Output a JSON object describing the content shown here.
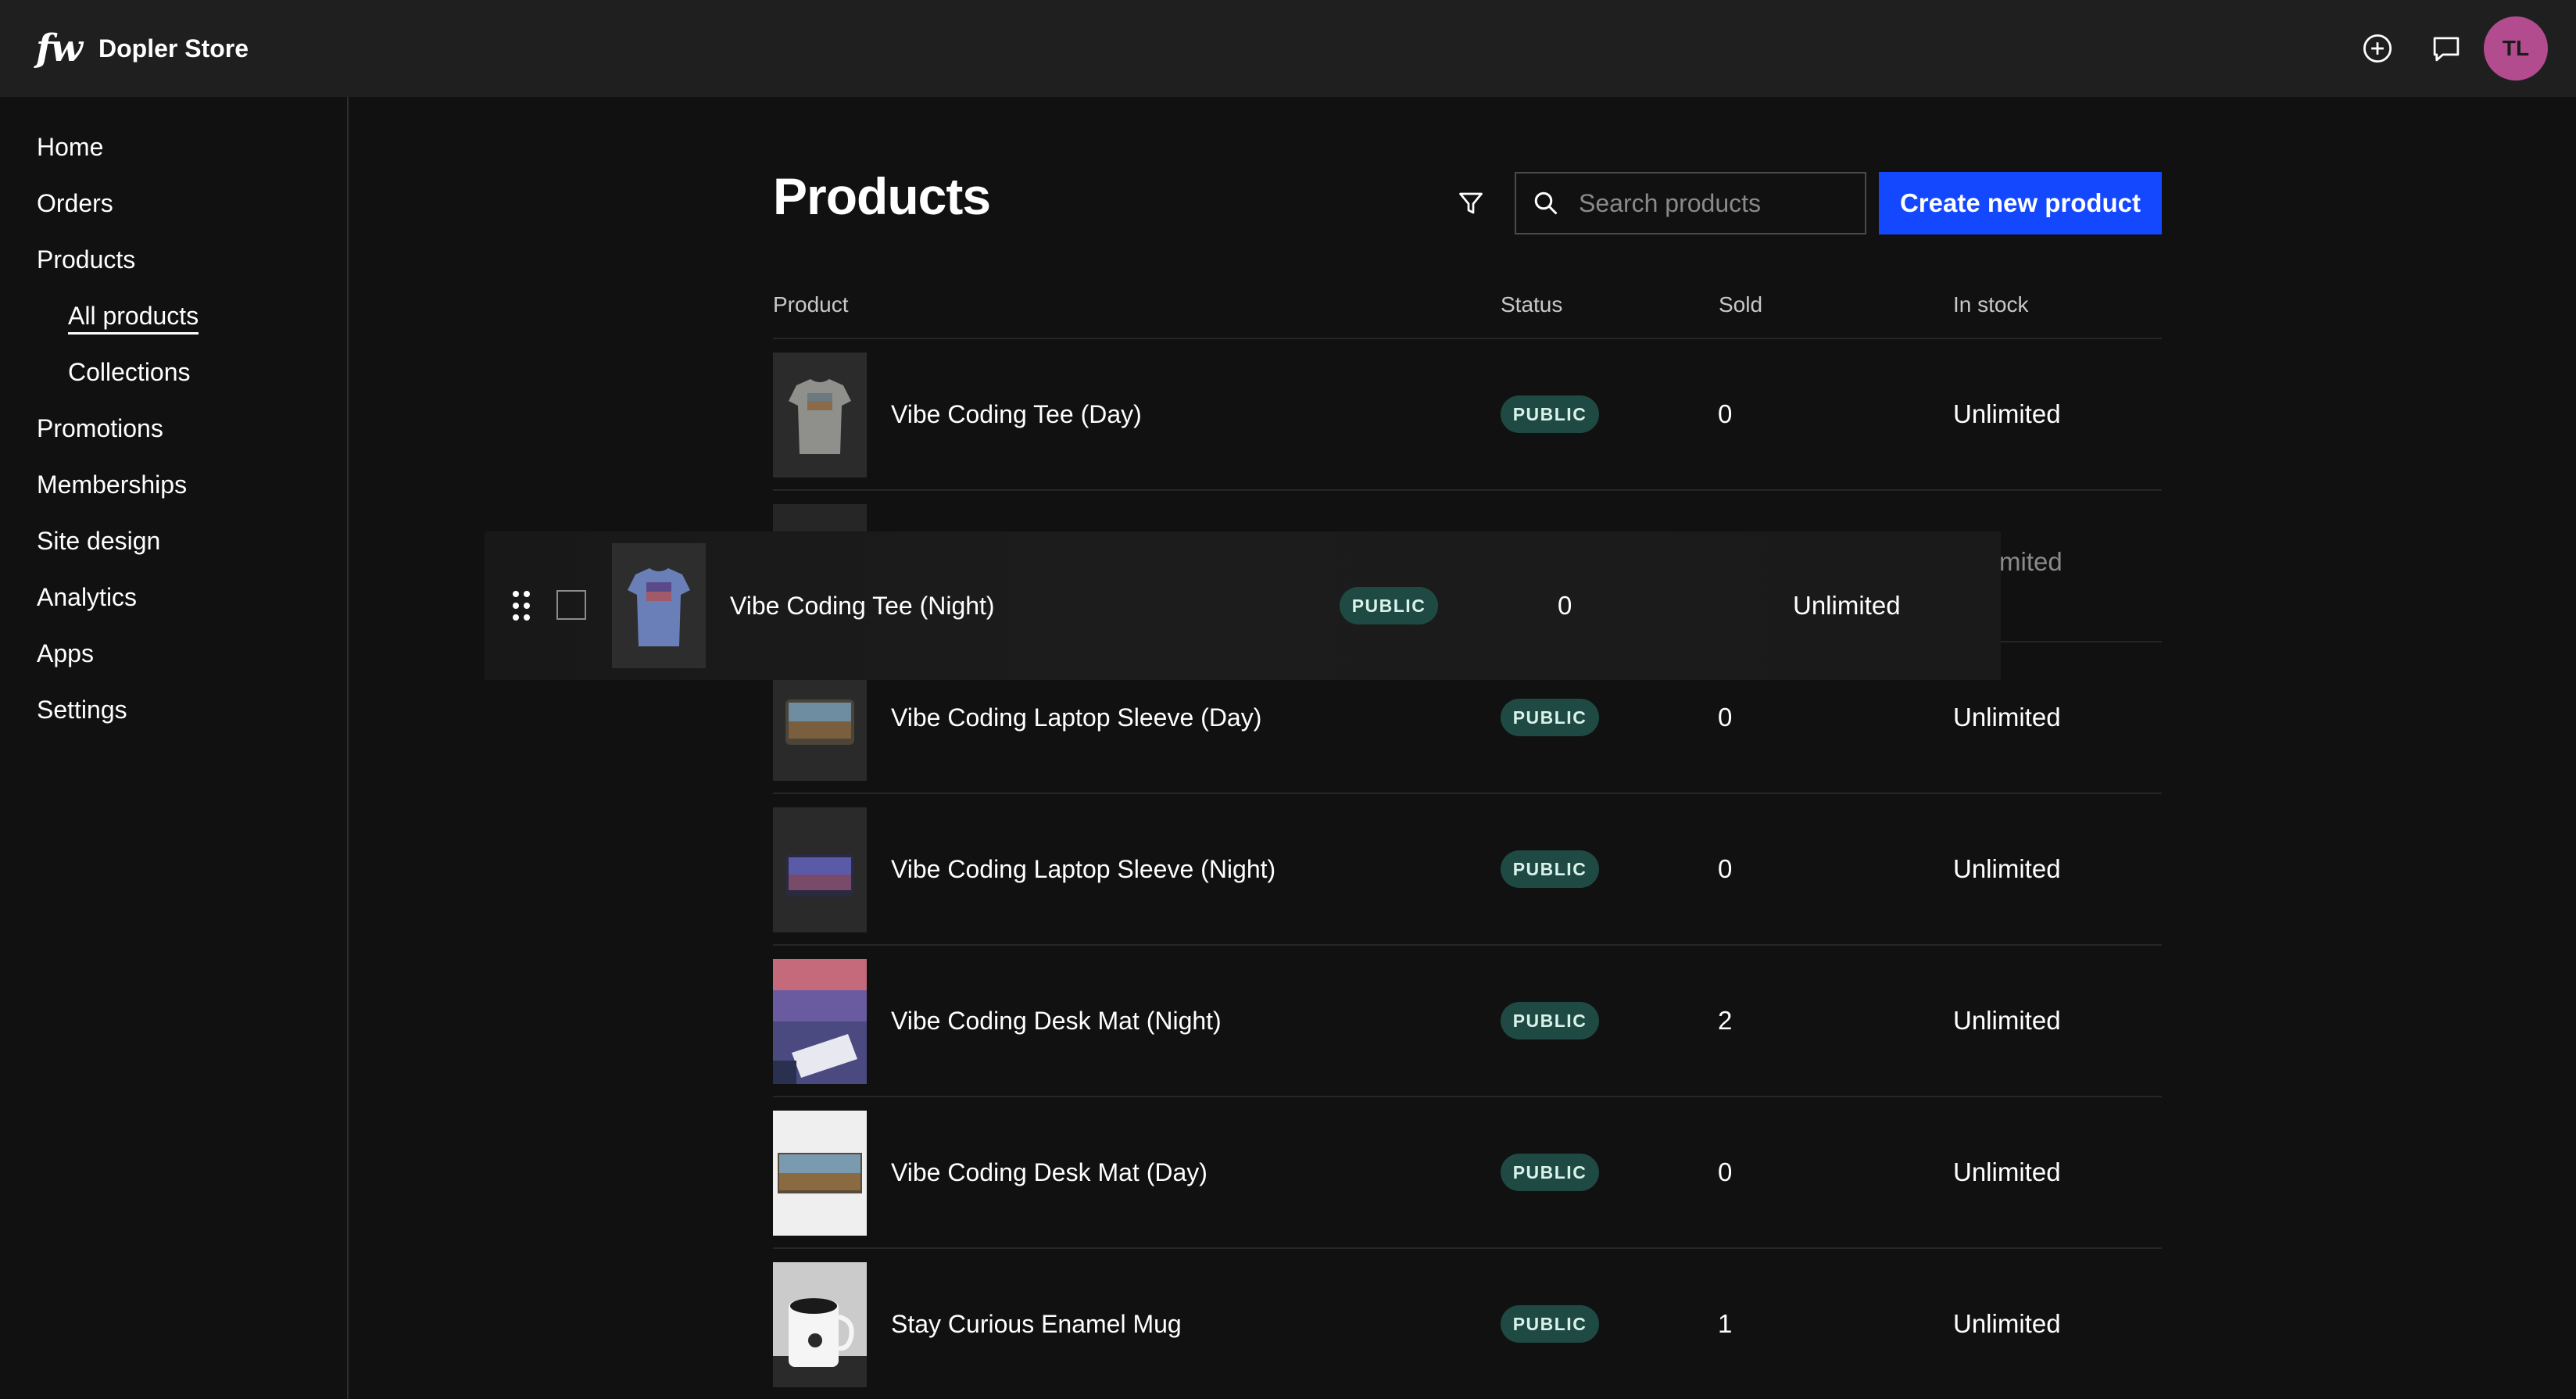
{
  "app": {
    "logo_text": "fw",
    "store_name": "Dopler Store",
    "user_initials": "TL",
    "accent_color": "#1448ff",
    "badge_color": "#1f4a43",
    "avatar_color": "#b24c8f"
  },
  "topbar": {
    "icons": [
      "plus-circle-icon",
      "chat-icon"
    ]
  },
  "sidebar": {
    "items": [
      {
        "label": "Home"
      },
      {
        "label": "Orders"
      },
      {
        "label": "Products"
      },
      {
        "label": "All products",
        "active": true,
        "sub": true
      },
      {
        "label": "Collections",
        "sub": true
      },
      {
        "label": "Promotions"
      },
      {
        "label": "Memberships"
      },
      {
        "label": "Site design"
      },
      {
        "label": "Analytics"
      },
      {
        "label": "Apps"
      },
      {
        "label": "Settings"
      }
    ]
  },
  "main": {
    "title": "Products",
    "search_placeholder": "Search products",
    "create_button": "Create new product",
    "columns": {
      "product": "Product",
      "status": "Status",
      "sold": "Sold",
      "stock": "In stock"
    },
    "rows": [
      {
        "name": "Vibe Coding Tee (Day)",
        "status": "PUBLIC",
        "sold": "0",
        "stock": "Unlimited",
        "thumb": "tee-gray"
      },
      {
        "name": "Vibe Coding Laptop Sleeve (Day)",
        "status": "PUBLIC",
        "sold": "0",
        "stock": "Unlimited",
        "thumb": "sleeve-day"
      },
      {
        "name": "Vibe Coding Laptop Sleeve (Night)",
        "status": "PUBLIC",
        "sold": "0",
        "stock": "Unlimited",
        "thumb": "sleeve-night"
      },
      {
        "name": "Vibe Coding Desk Mat (Night)",
        "status": "PUBLIC",
        "sold": "2",
        "stock": "Unlimited",
        "thumb": "mat-night"
      },
      {
        "name": "Vibe Coding Desk Mat (Day)",
        "status": "PUBLIC",
        "sold": "0",
        "stock": "Unlimited",
        "thumb": "mat-day"
      },
      {
        "name": "Stay Curious Enamel Mug",
        "status": "PUBLIC",
        "sold": "1",
        "stock": "Unlimited",
        "thumb": "mug"
      }
    ],
    "dragging_row": {
      "name": "Vibe Coding Tee (Night)",
      "status": "PUBLIC",
      "sold": "0",
      "stock": "Unlimited",
      "obscured_stock_text": "mited"
    }
  }
}
